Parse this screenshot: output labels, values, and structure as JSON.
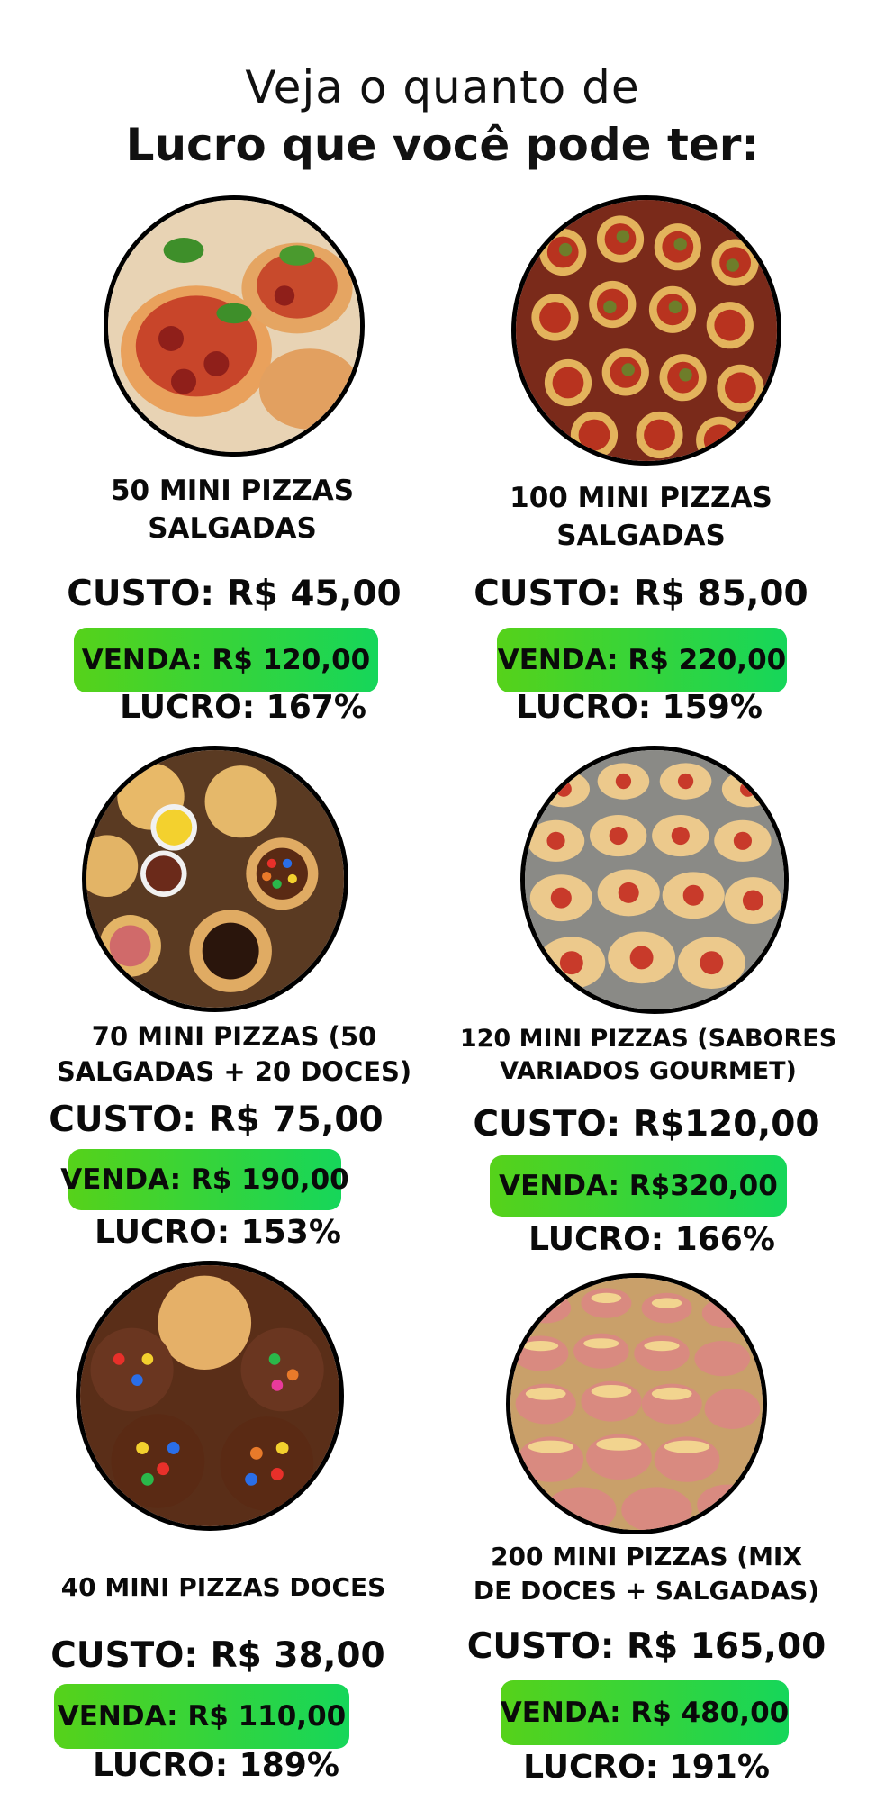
{
  "header": {
    "line1": "Veja o quanto de",
    "line2": "Lucro que você pode ter:"
  },
  "products": [
    {
      "title_line1": "50 MINI PIZZAS",
      "title_line2": "SALGADAS",
      "cost": "CUSTO: R$ 45,00",
      "sale": "VENDA: R$ 120,00",
      "profit": "LUCRO: 167%",
      "image": "savory-mini-pizzas-with-pepperoni-and-basil"
    },
    {
      "title_line1": "100 MINI PIZZAS",
      "title_line2": "SALGADAS",
      "cost": "CUSTO: R$ 85,00",
      "sale": "VENDA: R$ 220,00",
      "profit": "LUCRO: 159%",
      "image": "mini-pizzas-with-olives-and-tomato"
    },
    {
      "title_line1": "70 MINI PIZZAS (50",
      "title_line2": "SALGADAS + 20 DOCES)",
      "cost": "CUSTO: R$ 75,00",
      "sale": "VENDA: R$ 190,00",
      "profit": "LUCRO:  153%",
      "image": "assorted-sweet-and-savory-mini-pizzas-with-dips"
    },
    {
      "title_line1": "120 MINI PIZZAS (SABORES",
      "title_line2": "VARIADOS GOURMET)",
      "cost": "CUSTO: R$120,00",
      "sale": "VENDA: R$320,00",
      "profit": "LUCRO: 166%",
      "image": "tray-of-pepperoni-mini-pizzas"
    },
    {
      "title_line1": "40 MINI PIZZAS DOCES",
      "title_line2": "",
      "cost": "CUSTO: R$ 38,00",
      "sale": "VENDA: R$ 110,00",
      "profit": "LUCRO: 189%",
      "image": "chocolate-mini-pizzas-with-colorful-candies"
    },
    {
      "title_line1": "200 MINI PIZZAS (MIX",
      "title_line2": "DE DOCES + SALGADAS)",
      "cost": "CUSTO: R$ 165,00",
      "sale": "VENDA: R$ 480,00",
      "profit": "LUCRO: 191%",
      "image": "rows-of-ham-and-cheese-mini-pizzas"
    }
  ],
  "colors": {
    "sale_gradient_start": "#56d21a",
    "sale_gradient_end": "#16d65a",
    "text": "#0a0a0a",
    "circle_border": "#000000"
  }
}
